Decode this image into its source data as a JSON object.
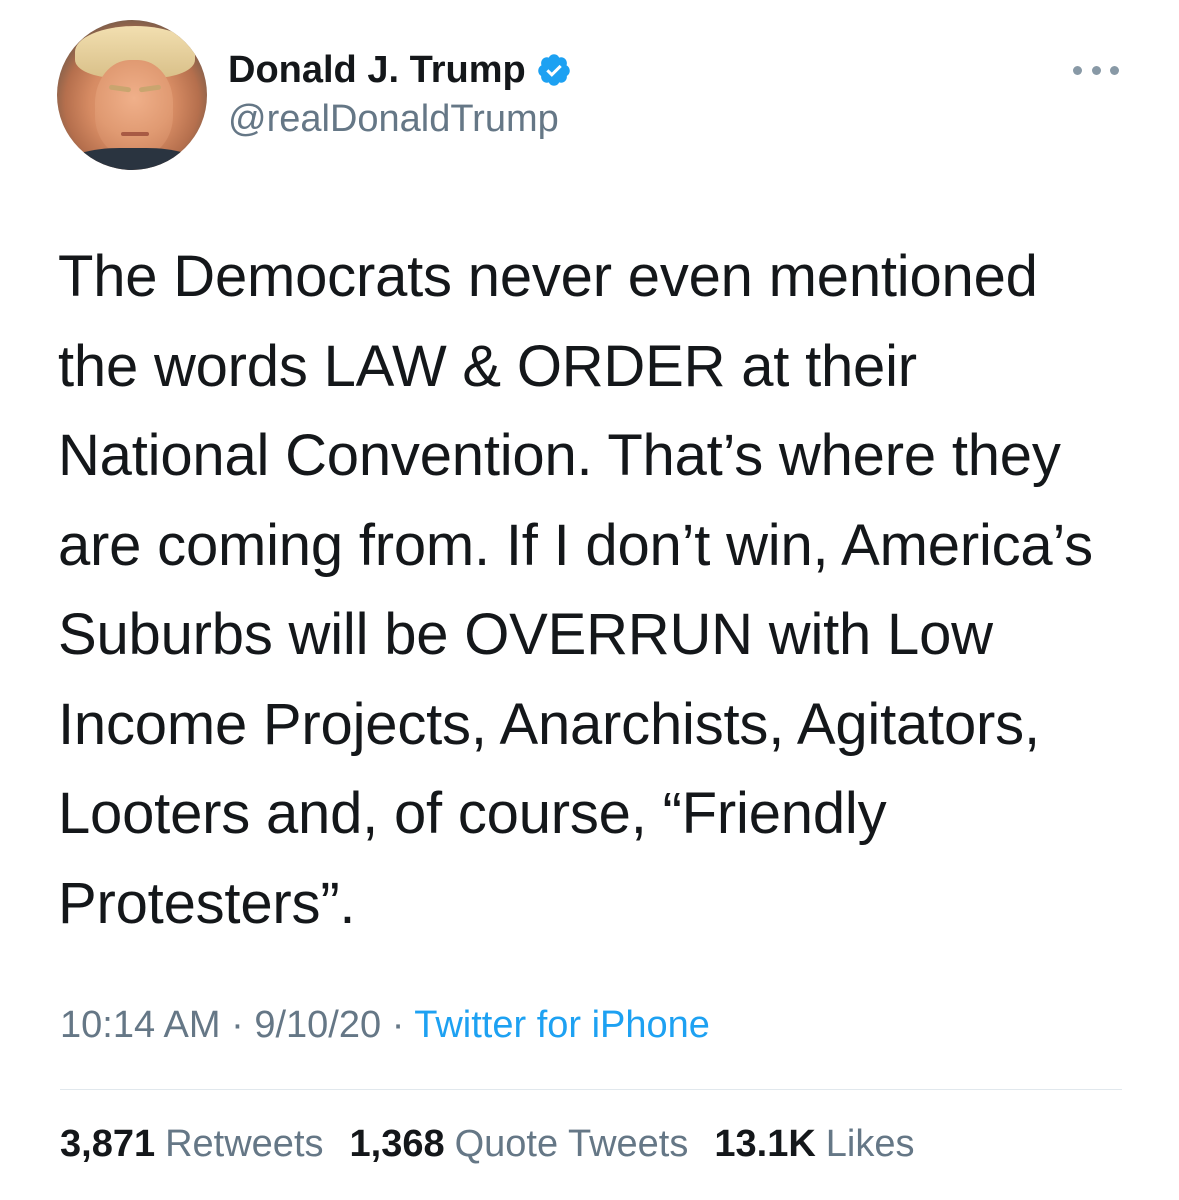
{
  "user": {
    "display_name": "Donald J. Trump",
    "handle": "@realDonaldTrump",
    "verified": true,
    "verified_color": "#1da1f2"
  },
  "tweet": {
    "lines": [
      "The Democrats never even mentioned",
      "the words LAW & ORDER at their",
      "National Convention. That’s where they",
      "are coming from. If I don’t win, America’s",
      "Suburbs will be OVERRUN with Low",
      "Income Projects, Anarchists, Agitators,",
      "Looters and, of course, “Friendly",
      "Protesters”."
    ]
  },
  "meta": {
    "time": "10:14 AM",
    "separator": " · ",
    "date": "9/10/20",
    "source": "Twitter for iPhone"
  },
  "stats": {
    "retweets_count": "3,871",
    "retweets_label": "Retweets",
    "quotes_count": "1,368",
    "quotes_label": "Quote Tweets",
    "likes_count": "13.1K",
    "likes_label": "Likes"
  },
  "colors": {
    "text": "#14171a",
    "secondary": "#657786",
    "link": "#1da1f2",
    "divider": "#e1e8ed"
  },
  "icons": {
    "verified": "verified-badge-icon",
    "more": "more-options-icon"
  }
}
